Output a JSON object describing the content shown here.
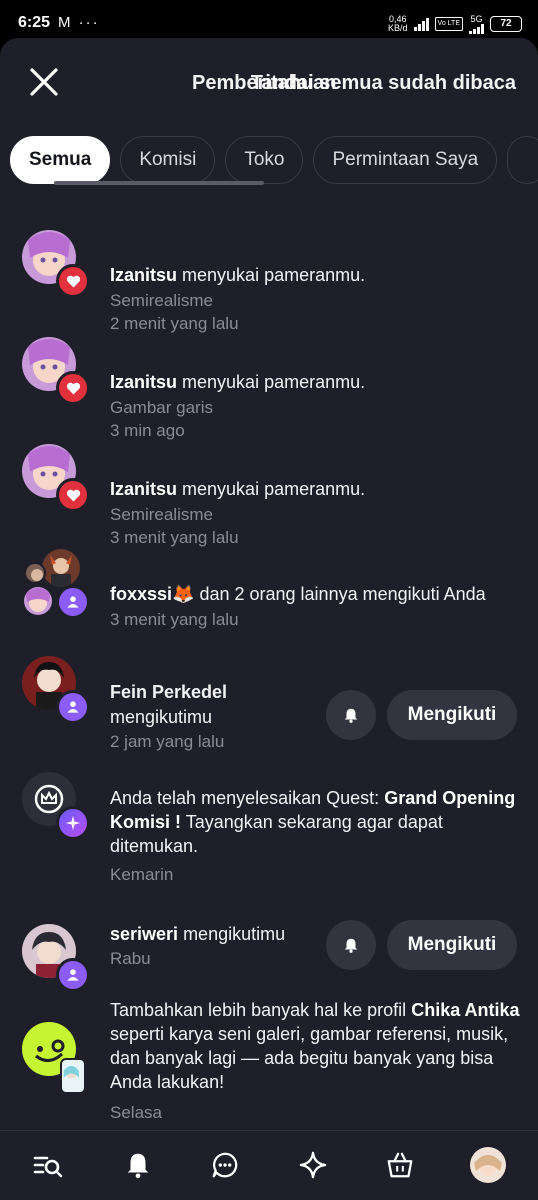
{
  "status_bar": {
    "time": "6:25",
    "left_icons": "M ···",
    "speed_value": "0,46",
    "speed_unit": "KB/d",
    "volte": "Vo LTE",
    "net": "5G",
    "battery": "72"
  },
  "header": {
    "title": "Pemberitahuan",
    "mark_all_read": "Tandai semua sudah dibaca"
  },
  "tabs": [
    {
      "label": "Semua",
      "active": true
    },
    {
      "label": "Komisi",
      "active": false
    },
    {
      "label": "Toko",
      "active": false
    },
    {
      "label": "Permintaan Saya",
      "active": false
    }
  ],
  "notifications": [
    {
      "actor": "Izanitsu",
      "action": "menyukai pameranmu.",
      "sub": "Semirealisme",
      "time": "2 menit yang lalu",
      "badge": "heart-icon"
    },
    {
      "actor": "Izanitsu",
      "action": "menyukai pameranmu.",
      "sub": "Gambar garis",
      "time": "3 min ago",
      "badge": "heart-icon"
    },
    {
      "actor": "Izanitsu",
      "action": "menyukai pameranmu.",
      "sub": "Semirealisme",
      "time": "3 menit yang lalu",
      "badge": "heart-icon"
    },
    {
      "actor": "foxxssi🦊",
      "action": "dan 2 orang lainnya mengikuti Anda",
      "time": "3 menit yang lalu",
      "badge": "person-icon"
    },
    {
      "actor": "Fein Perkedel",
      "action": "mengikutimu",
      "time": "2 jam yang lalu",
      "badge": "person-icon",
      "button": "Mengikuti"
    },
    {
      "prefix": "Anda telah menyelesaikan Quest:",
      "bold": "Grand Opening Komisi !",
      "suffix": "Tayangkan sekarang agar dapat ditemukan.",
      "time": "Kemarin",
      "badge": "sparkle-icon"
    },
    {
      "actor": "seriweri",
      "action": "mengikutimu",
      "time": "Rabu",
      "badge": "person-icon",
      "button": "Mengikuti"
    },
    {
      "prefix": "Tambahkan lebih banyak hal ke profil",
      "bold": "Chika Antika",
      "suffix": "seperti karya seni galeri, gambar referensi, musik, dan banyak lagi — ada begitu banyak yang bisa Anda lakukan!",
      "time": "Selasa"
    }
  ],
  "colors": {
    "background": "#1e1f29",
    "button": "#33343f",
    "heart_badge": "#e0313c",
    "person_badge": "#8b5cf6",
    "brand_green": "#c6f432"
  },
  "bottom_nav": [
    "search-list-icon",
    "bell-icon",
    "chat-icon",
    "sparkle-icon",
    "shop-bag-icon",
    "profile-avatar"
  ]
}
